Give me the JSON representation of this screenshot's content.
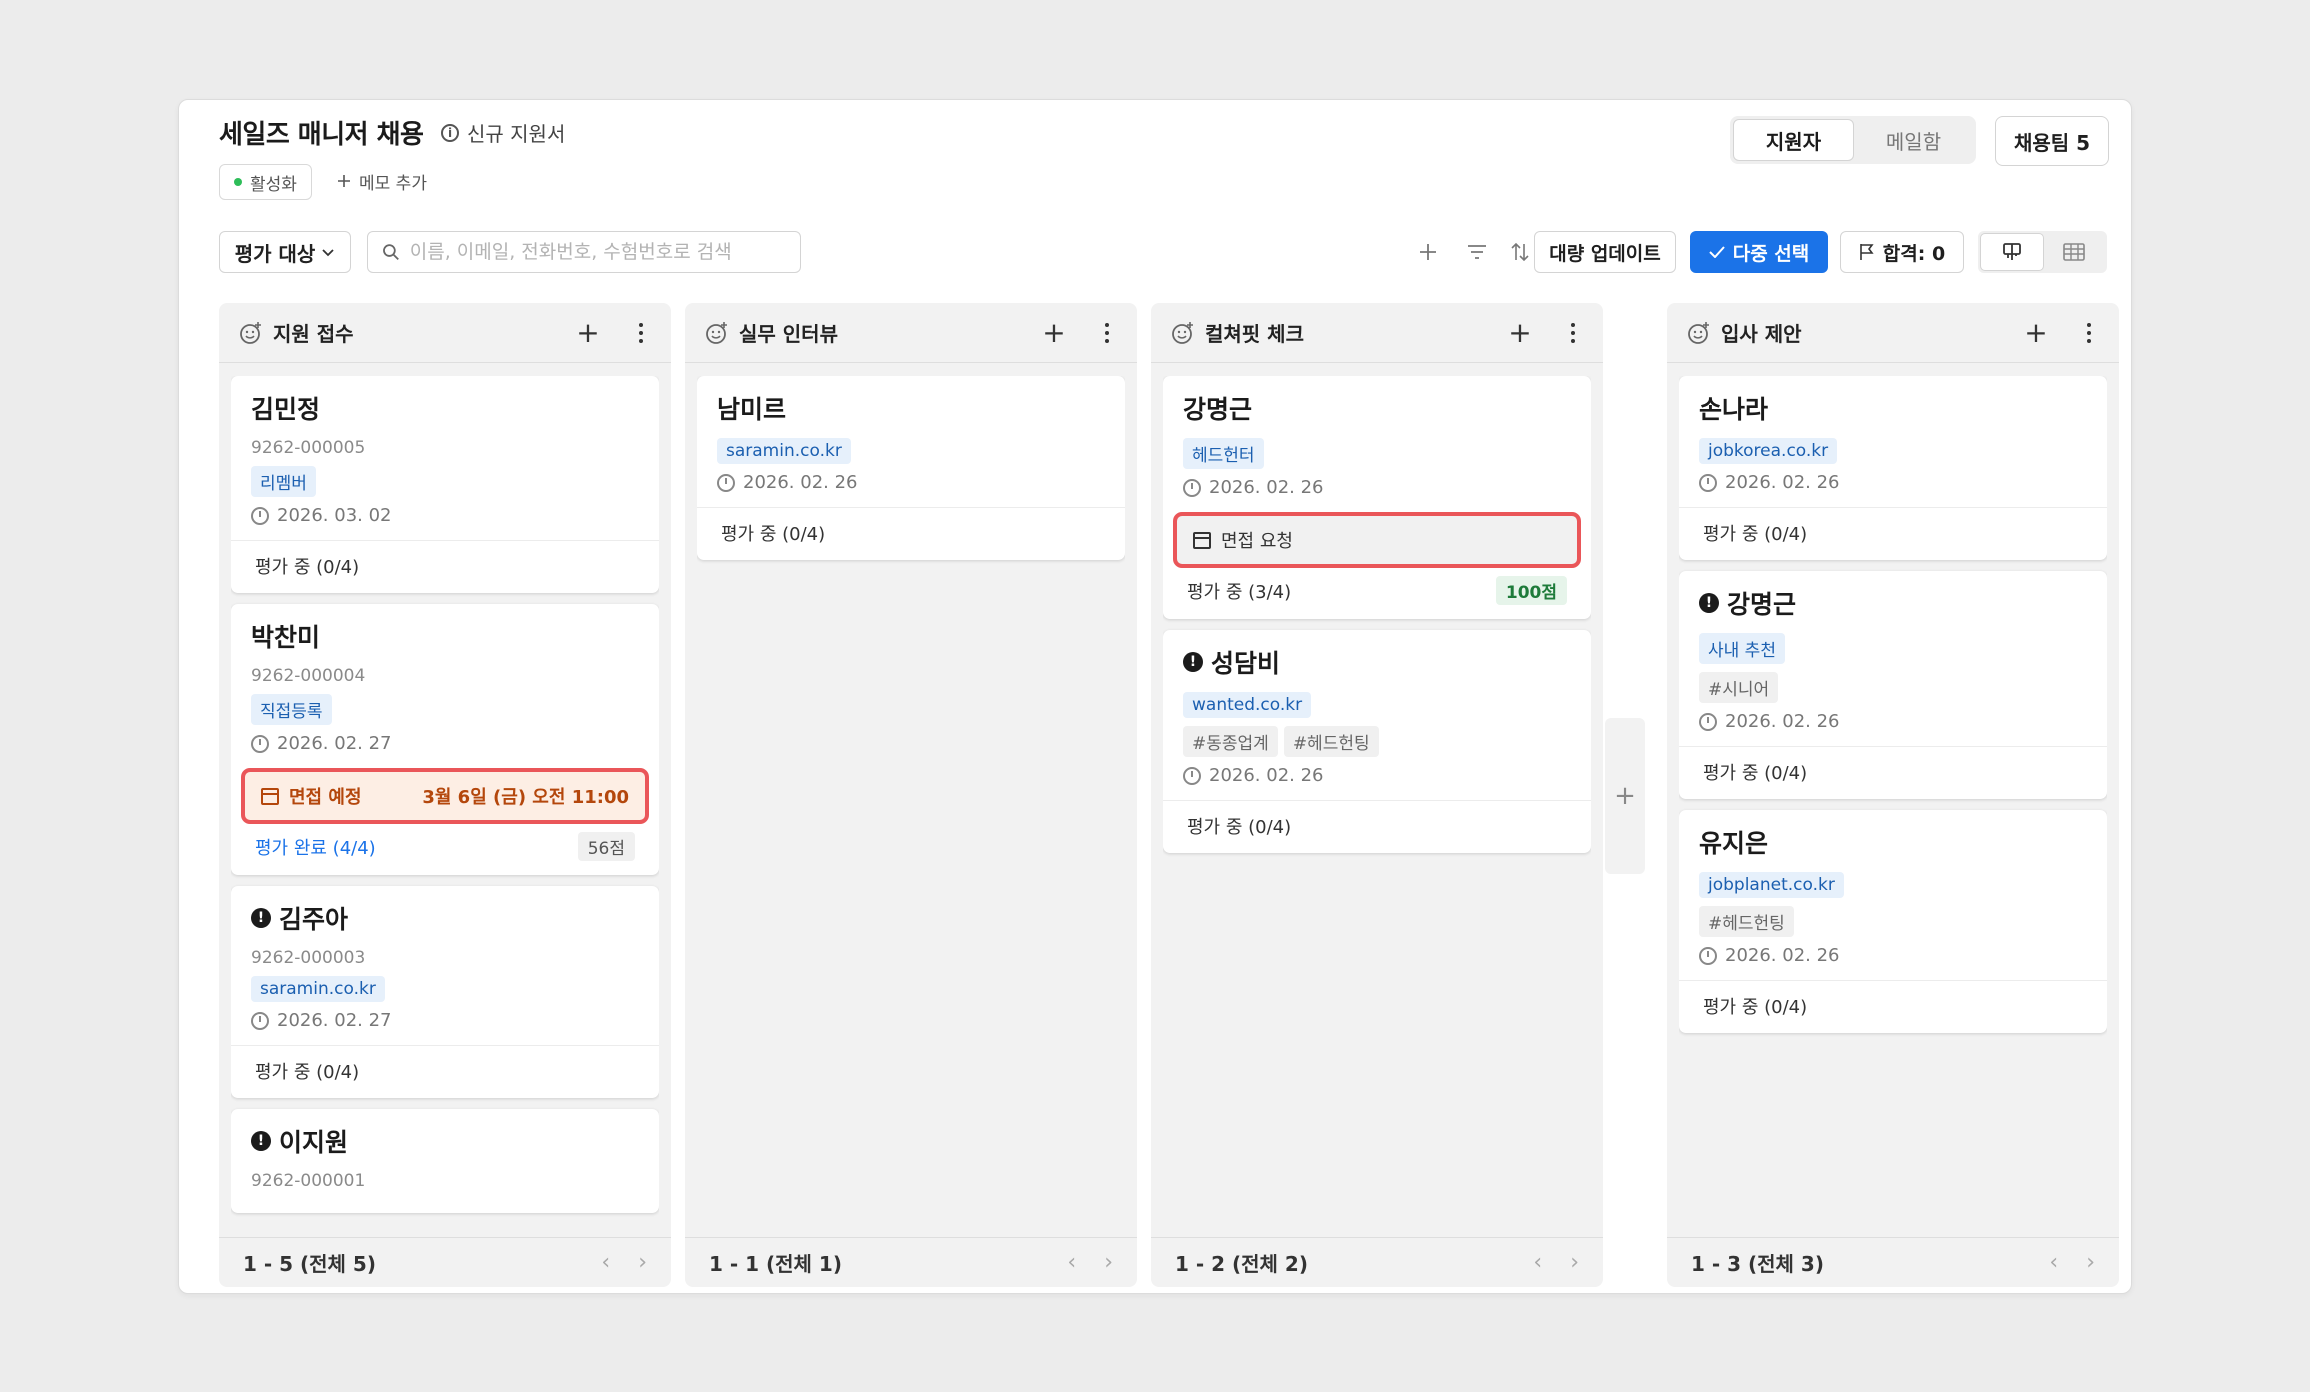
{
  "header": {
    "title": "세일즈 매니저 채용",
    "subtitle": "신규 지원서",
    "status": "활성화",
    "memo_add": "메모 추가",
    "tabs": [
      "지원자",
      "메일함"
    ],
    "team_button": "채용팀 5"
  },
  "toolbar": {
    "filter_label": "평가 대상",
    "search_placeholder": "이름, 이메일, 전화번호, 수험번호로 검색",
    "bulk_update": "대량 업데이트",
    "multi_select": "다중 선택",
    "pass_count": "합격:  0"
  },
  "columns": [
    {
      "title": "지원 접수",
      "footer": "1 - 5 (전체 5)",
      "cards": [
        {
          "name": "김민정",
          "alert": false,
          "app_no": "9262-000005",
          "tags": [
            {
              "text": "리멤버",
              "style": "blue"
            }
          ],
          "date": "2026. 03. 02",
          "eval": "평가 중 (0/4)"
        },
        {
          "name": "박찬미",
          "alert": false,
          "app_no": "9262-000004",
          "tags": [
            {
              "text": "직접등록",
              "style": "blue"
            }
          ],
          "date": "2026. 02. 27",
          "interview": {
            "label": "면접 예정",
            "value": "3월 6일 (금) 오전 11:00"
          },
          "eval": "평가 완료 (4/4)",
          "eval_done": true,
          "score": "56점"
        },
        {
          "name": "김주아",
          "alert": true,
          "app_no": "9262-000003",
          "tags": [
            {
              "text": "saramin.co.kr",
              "style": "blue"
            }
          ],
          "date": "2026. 02. 27",
          "eval": "평가 중 (0/4)"
        },
        {
          "name": "이지원",
          "alert": true,
          "app_no": "9262-000001",
          "tags": [],
          "date": "",
          "eval": ""
        }
      ]
    },
    {
      "title": "실무 인터뷰",
      "footer": "1 - 1 (전체 1)",
      "cards": [
        {
          "name": "남미르",
          "alert": false,
          "app_no": "",
          "tags": [
            {
              "text": "saramin.co.kr",
              "style": "blue"
            }
          ],
          "date": "2026. 02. 26",
          "eval": "평가 중 (0/4)"
        }
      ]
    },
    {
      "title": "컬쳐핏 체크",
      "footer": "1 - 2 (전체 2)",
      "cards": [
        {
          "name": "강명근",
          "alert": false,
          "app_no": "",
          "tags": [
            {
              "text": "헤드헌터",
              "style": "blue"
            }
          ],
          "date": "2026. 02. 26",
          "interview_request": {
            "label": "면접 요청"
          },
          "eval": "평가 중 (3/4)",
          "score": "100점",
          "score_style": "green"
        },
        {
          "name": "성담비",
          "alert": true,
          "app_no": "",
          "tags": [
            {
              "text": "wanted.co.kr",
              "style": "blue"
            },
            {
              "text": "#동종업계",
              "style": "gray"
            },
            {
              "text": "#헤드헌팅",
              "style": "gray"
            }
          ],
          "date": "2026. 02. 26",
          "eval": "평가 중 (0/4)"
        }
      ]
    },
    {
      "title": "입사 제안",
      "footer": "1 - 3 (전체 3)",
      "cards": [
        {
          "name": "손나라",
          "alert": false,
          "app_no": "",
          "tags": [
            {
              "text": "jobkorea.co.kr",
              "style": "blue"
            }
          ],
          "date": "2026. 02. 26",
          "eval": "평가 중 (0/4)"
        },
        {
          "name": "강명근",
          "alert": true,
          "app_no": "",
          "tags": [
            {
              "text": "사내 추천",
              "style": "blue"
            },
            {
              "text": "#시니어",
              "style": "gray"
            }
          ],
          "date": "2026. 02. 26",
          "eval": "평가 중 (0/4)"
        },
        {
          "name": "유지은",
          "alert": false,
          "app_no": "",
          "tags": [
            {
              "text": "jobplanet.co.kr",
              "style": "blue"
            },
            {
              "text": "#헤드헌팅",
              "style": "gray"
            }
          ],
          "date": "2026. 02. 26",
          "eval": "평가 중 (0/4)"
        }
      ]
    }
  ],
  "colors": {
    "accent": "#1b73e8",
    "highlight": "#ea5659",
    "active_dot": "#2ebd59"
  }
}
